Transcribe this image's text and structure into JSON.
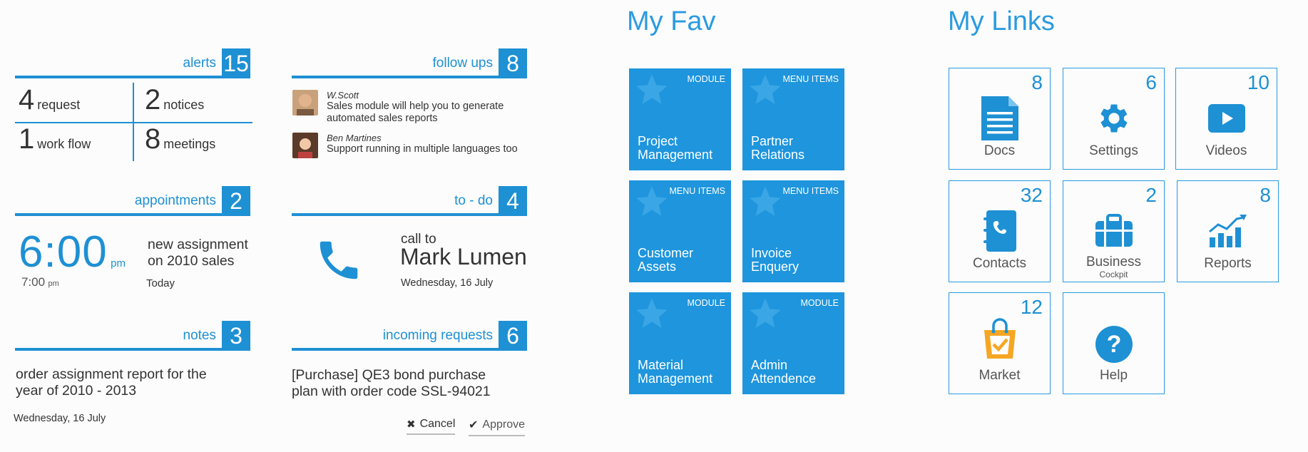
{
  "widgets": {
    "alerts": {
      "title": "alerts",
      "count": "15",
      "items": [
        {
          "num": "4",
          "label": "request"
        },
        {
          "num": "2",
          "label": "notices"
        },
        {
          "num": "1",
          "label": "work flow"
        },
        {
          "num": "8",
          "label": "meetings"
        }
      ]
    },
    "followups": {
      "title": "follow ups",
      "count": "8",
      "items": [
        {
          "name": "W.Scott",
          "line1": "Sales module will help you to generate",
          "line2": "automated sales reports"
        },
        {
          "name": "Ben Martines",
          "line1": "Support running in multiple languages too",
          "line2": ""
        }
      ]
    },
    "appointments": {
      "title": "appointments",
      "count": "2",
      "time": "6:00",
      "ampm": "pm",
      "next_time": "7:00",
      "next_ampm": "pm",
      "desc1": "new assignment",
      "desc2": "on 2010 sales",
      "day": "Today"
    },
    "todo": {
      "title": "to - do",
      "count": "4",
      "prefix": "call to",
      "name": "Mark Lumen",
      "date": "Wednesday, 16 July"
    },
    "notes": {
      "title": "notes",
      "count": "3",
      "line1": "order assignment report for the",
      "line2": "year of 2010 - 2013",
      "date": "Wednesday, 16 July"
    },
    "incoming": {
      "title": "incoming requests",
      "count": "6",
      "line1": "[Purchase] QE3 bond purchase",
      "line2": "plan with order code SSL-94021",
      "cancel": "Cancel",
      "approve": "Approve"
    }
  },
  "fav": {
    "title": "My Fav",
    "tiles": [
      {
        "tag": "MODULE",
        "l1": "Project",
        "l2": "Management",
        "icon": "star-icon"
      },
      {
        "tag": "MENU ITEMS",
        "l1": "Partner",
        "l2": "Relations",
        "icon": "star-icon"
      },
      {
        "tag": "MENU ITEMS",
        "l1": "Customer",
        "l2": "Assets",
        "icon": "star-icon"
      },
      {
        "tag": "MENU ITEMS",
        "l1": "Invoice",
        "l2": "Enquery",
        "icon": "star-icon"
      },
      {
        "tag": "MODULE",
        "l1": "Material",
        "l2": "Management",
        "icon": "star-icon"
      },
      {
        "tag": "MODULE",
        "l1": "Admin",
        "l2": "Attendence",
        "icon": "star-icon"
      }
    ]
  },
  "links": {
    "title": "My Links",
    "tiles": [
      {
        "count": "8",
        "label": "Docs",
        "sub": "",
        "icon": "document-icon"
      },
      {
        "count": "6",
        "label": "Settings",
        "sub": "",
        "icon": "gear-icon"
      },
      {
        "count": "10",
        "label": "Videos",
        "sub": "",
        "icon": "play-icon"
      },
      {
        "count": "32",
        "label": "Contacts",
        "sub": "",
        "icon": "address-book-icon"
      },
      {
        "count": "2",
        "label": "Business",
        "sub": "Cockpit",
        "icon": "briefcase-icon"
      },
      {
        "count": "8",
        "label": "Reports",
        "sub": "",
        "icon": "chart-icon"
      },
      {
        "count": "12",
        "label": "Market",
        "sub": "",
        "icon": "shopping-bag-icon"
      },
      {
        "count": "",
        "label": "Help",
        "sub": "",
        "icon": "help-icon"
      }
    ]
  },
  "colors": {
    "accent": "#1e90d4",
    "tile": "#1e95dc",
    "market_bag": "#f5a623"
  }
}
